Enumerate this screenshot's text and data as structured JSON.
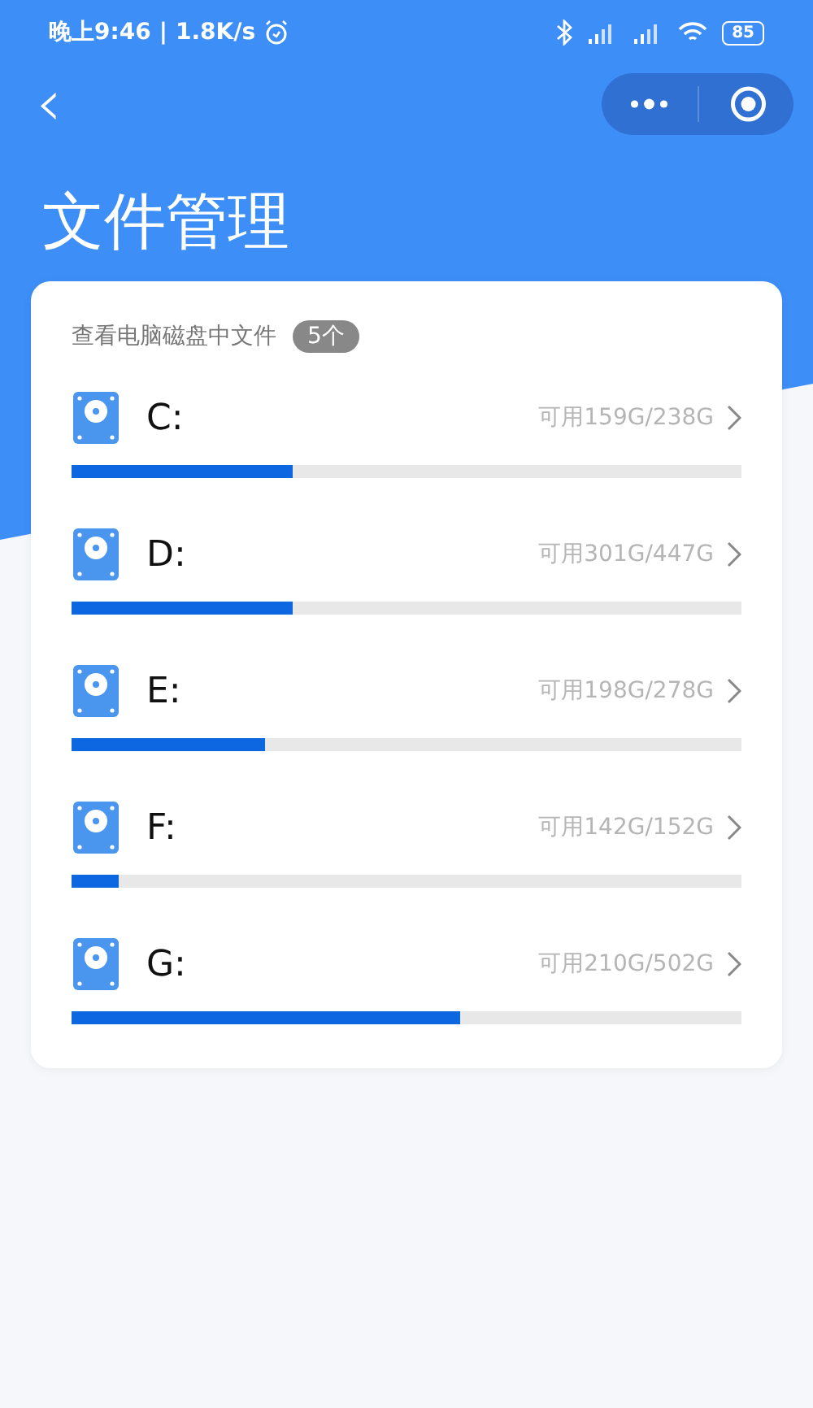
{
  "status_bar": {
    "time": "晚上9:46",
    "separator": "|",
    "speed": "1.8K/s",
    "battery": "85"
  },
  "nav": {
    "back": "‹"
  },
  "title": "文件管理",
  "card": {
    "heading": "查看电脑磁盘中文件",
    "count": "5个",
    "disks": [
      {
        "name": "C:",
        "usage": "可用159G/238G",
        "level": 0.33
      },
      {
        "name": "D:",
        "usage": "可用301G/447G",
        "level": 0.33
      },
      {
        "name": "E:",
        "usage": "可用198G/278G",
        "level": 0.29
      },
      {
        "name": "F:",
        "usage": "可用142G/152G",
        "level": 0.07
      },
      {
        "name": "G:",
        "usage": "可用210G/502G",
        "level": 0.58
      }
    ]
  }
}
